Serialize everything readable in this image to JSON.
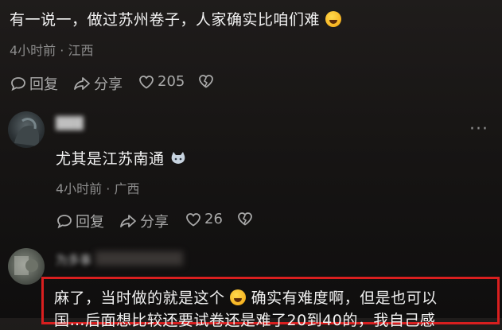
{
  "comment1": {
    "text": "有一说一，做过苏州卷子，人家确实比咱们难",
    "meta": "4小时前 · 江西",
    "reply_label": "回复",
    "share_label": "分享",
    "likes": "205"
  },
  "comment2": {
    "username": "███",
    "text": "尤其是江苏南通",
    "meta": "4小时前 · 广西",
    "reply_label": "回复",
    "share_label": "分享",
    "likes": "26"
  },
  "comment3": {
    "username": "为多事",
    "text_part1": "麻了，当时做的就是这个",
    "text_part2": "确实有难度啊，但是也可以",
    "text_line2": "国…后面想比较还要试卷还是难了20到40的，我自己感"
  },
  "colors": {
    "highlight_border": "#d91f1f",
    "meta_gray": "#8c8c8c"
  }
}
